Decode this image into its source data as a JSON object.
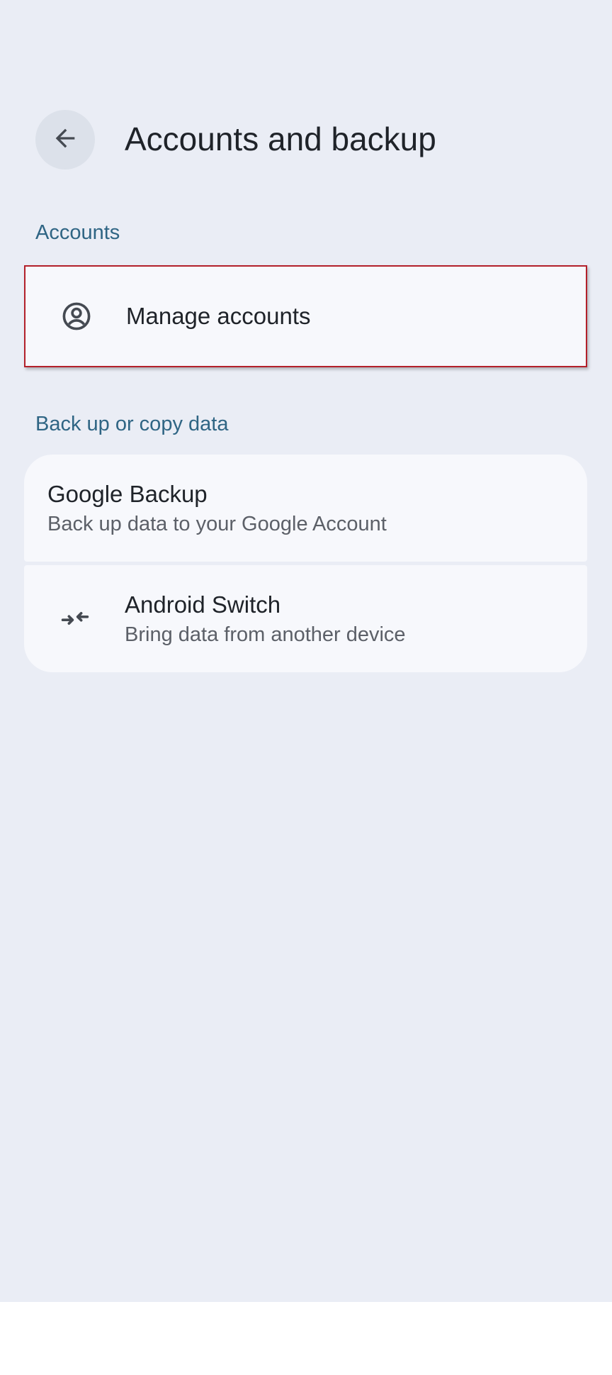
{
  "header": {
    "back_icon": "arrow-back-icon",
    "title": "Accounts and backup"
  },
  "sections": {
    "accounts": {
      "header": "Accounts",
      "items": [
        {
          "icon": "account-circle-icon",
          "title": "Manage accounts"
        }
      ]
    },
    "backup": {
      "header": "Back up or copy data",
      "items": [
        {
          "title": "Google Backup",
          "subtitle": "Back up data to your Google Account"
        },
        {
          "icon": "compare-arrows-icon",
          "title": "Android Switch",
          "subtitle": "Bring data from another device"
        }
      ]
    }
  },
  "colors": {
    "background": "#eaedf5",
    "card": "#f7f8fc",
    "section_header": "#2f6584",
    "highlight_border": "#b3202a",
    "back_button_bg": "#dce1ea"
  }
}
